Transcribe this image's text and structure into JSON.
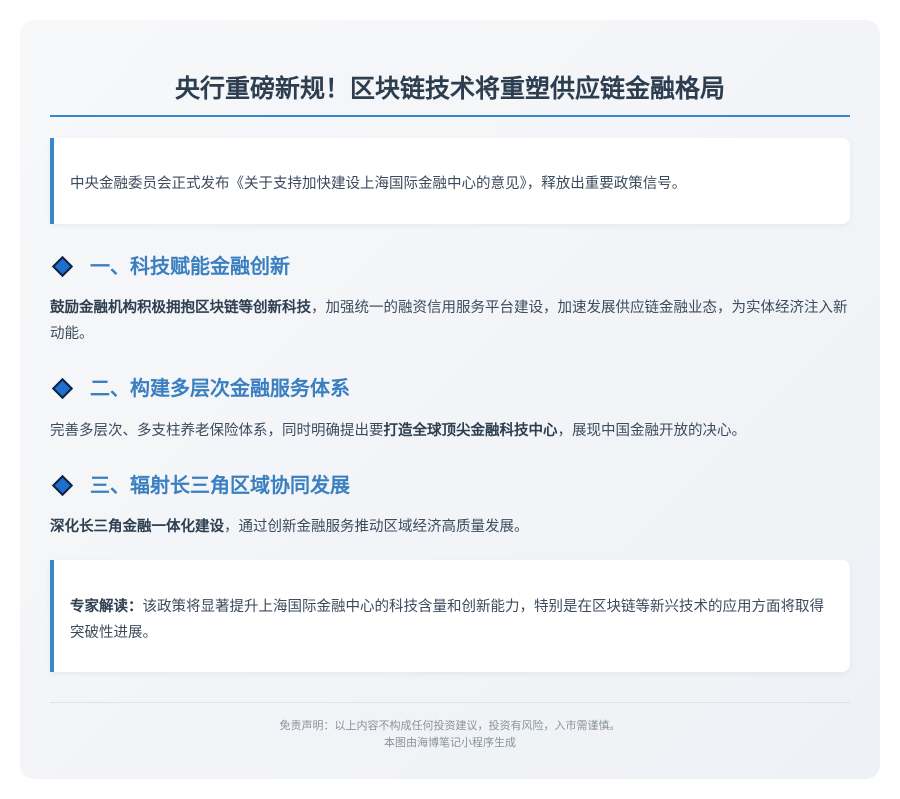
{
  "title": "央行重磅新规！区块链技术将重塑供应链金融格局",
  "intro": "中央金融委员会正式发布《关于支持加快建设上海国际金融中心的意见》，释放出重要政策信号。",
  "sections": [
    {
      "heading": "一、科技赋能金融创新",
      "bold": "鼓励金融机构积极拥抱区块链等创新科技",
      "text": "，加强统一的融资信用服务平台建设，加速发展供应链金融业态，为实体经济注入新动能。"
    },
    {
      "heading": "二、构建多层次金融服务体系",
      "before": "完善多层次、多支柱养老保险体系，同时明确提出要",
      "bold": "打造全球顶尖金融科技中心",
      "after": "，展现中国金融开放的决心。"
    },
    {
      "heading": "三、辐射长三角区域协同发展",
      "bold": "深化长三角金融一体化建设",
      "text": "，通过创新金融服务推动区域经济高质量发展。"
    }
  ],
  "expert": {
    "label": "专家解读：",
    "text": "该政策将显著提升上海国际金融中心的科技含量和创新能力，特别是在区块链等新兴技术的应用方面将取得突破性进展。"
  },
  "footer": {
    "disclaimer": "免责声明：以上内容不构成任何投资建议，投资有风险，入市需谨慎。",
    "generated_by": "本图由海博笔记小程序生成"
  }
}
